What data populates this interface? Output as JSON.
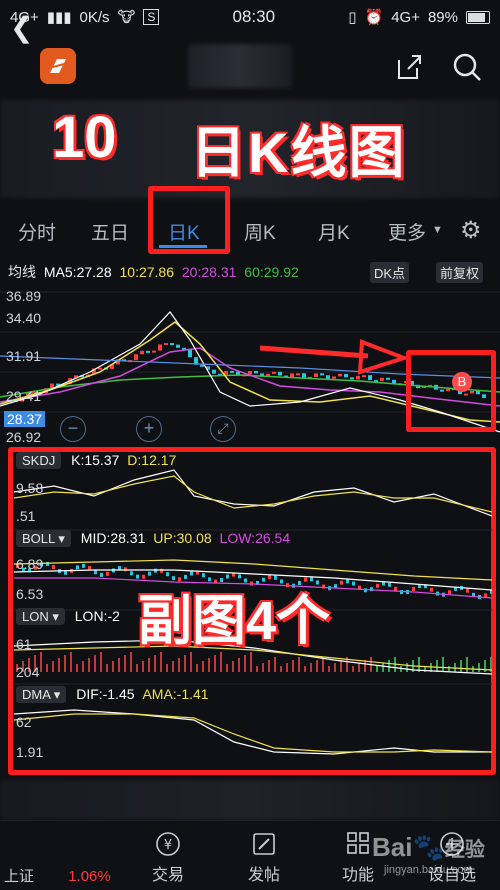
{
  "status_bar": {
    "network": "4G+",
    "speed": "0K/s",
    "time": "08:30",
    "network2": "4G+",
    "battery": "89%"
  },
  "overlay": {
    "big_number": "10",
    "big_title": "日K线图",
    "subchart_title": "副图4个"
  },
  "tabs": [
    {
      "label": "分时"
    },
    {
      "label": "五日"
    },
    {
      "label": "日K"
    },
    {
      "label": "周K"
    },
    {
      "label": "月K"
    },
    {
      "label": "更多"
    }
  ],
  "ma_legend": {
    "label": "均线",
    "ma5": "MA5:27.28",
    "ma10": "10:27.86",
    "ma20": "20:28.31",
    "ma60": "60:29.92",
    "dk_button": "DK点",
    "adjust_button": "前复权"
  },
  "main_chart": {
    "y_ticks": [
      "36.89",
      "34.40",
      "31.91",
      "29.41",
      "28.37",
      "26.92"
    ],
    "current_price": "28.37",
    "b_marker": "B"
  },
  "indicators": {
    "skdj": {
      "name": "SKDJ",
      "k": "K:15.37",
      "d": "D:12.17",
      "ticks": [
        "9.58",
        ".51"
      ]
    },
    "boll": {
      "name": "BOLL",
      "mid": "MID:28.31",
      "up": "UP:30.08",
      "low": "LOW:26.54",
      "ticks": [
        "6.89",
        "6.53"
      ]
    },
    "lon": {
      "name": "LON",
      "value": "LON:-2",
      "ticks": [
        "61",
        "204"
      ]
    },
    "dma": {
      "name": "DMA",
      "dif": "DIF:-1.45",
      "ama": "AMA:-1.41",
      "ticks": [
        "62",
        "1.91"
      ]
    }
  },
  "bottom_bar": {
    "left_partial": "上证",
    "left_change": "1.06%",
    "items": [
      {
        "label": "交易",
        "icon": "yuan-transfer-icon"
      },
      {
        "label": "发帖",
        "icon": "edit-icon"
      },
      {
        "label": "功能",
        "icon": "grid-icon"
      },
      {
        "label": "设自选",
        "icon": "star-add-icon"
      }
    ]
  },
  "watermark": {
    "brand": "Bai",
    "brand2": "经验",
    "url": "jingyan.baidu.com"
  },
  "colors": {
    "accent_blue": "#3c8ce6",
    "annotation_red": "#ff1e1e",
    "ma5": "#ffffff",
    "ma10": "#f2e24a",
    "ma20": "#d54be0",
    "ma60": "#3fbf3f",
    "up_candle": "#ff3b3b",
    "down_candle": "#27c7e0"
  }
}
